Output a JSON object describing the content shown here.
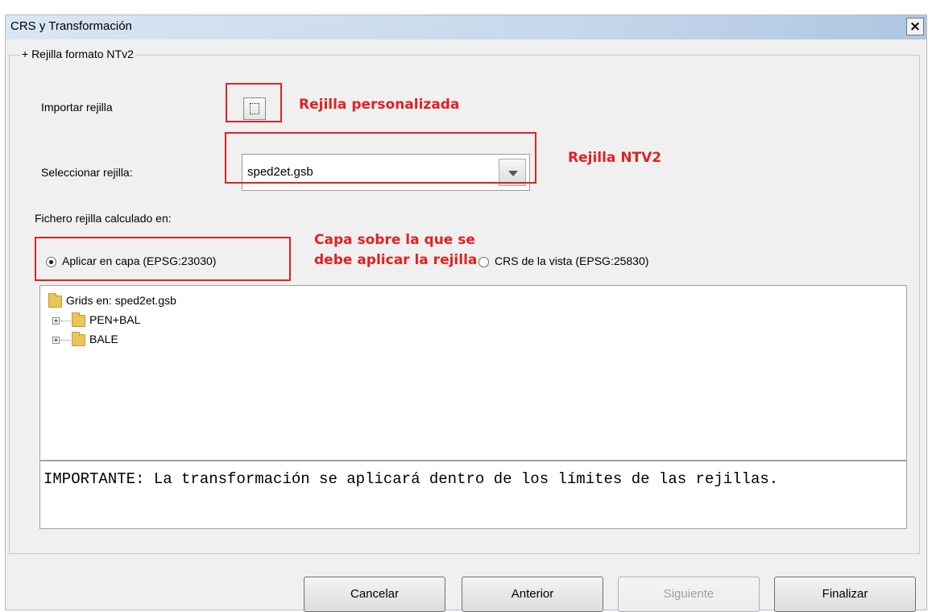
{
  "window": {
    "title": "CRS y Transformación",
    "close_label": "×"
  },
  "group": {
    "title": "+ Rejilla formato NTv2"
  },
  "import": {
    "label": "Importar rejilla"
  },
  "select": {
    "label": "Seleccionar rejilla:",
    "value": "sped2et.gsb"
  },
  "calc": {
    "label": "Fichero rejilla calculado en:"
  },
  "radios": [
    {
      "label": "Aplicar en capa (EPSG:23030)",
      "selected": true
    },
    {
      "label": "CRS de la vista (EPSG:25830)",
      "selected": false
    }
  ],
  "tree": {
    "root": "Grids en: sped2et.gsb",
    "children": [
      {
        "label": "PEN+BAL",
        "expander": "+"
      },
      {
        "label": "BALE",
        "expander": "+"
      }
    ]
  },
  "note": "IMPORTANTE: La transformación se aplicará dentro de los límites de las rejillas.",
  "buttons": {
    "cancel": "Cancelar",
    "back": "Anterior",
    "next": "Siguiente",
    "finish": "Finalizar"
  },
  "annotations": {
    "custom_grid": "Rejilla personalizada",
    "ntv2_grid": "Rejilla NTV2",
    "layer_line1": "Capa sobre la que se",
    "layer_line2": "debe aplicar la rejilla"
  }
}
